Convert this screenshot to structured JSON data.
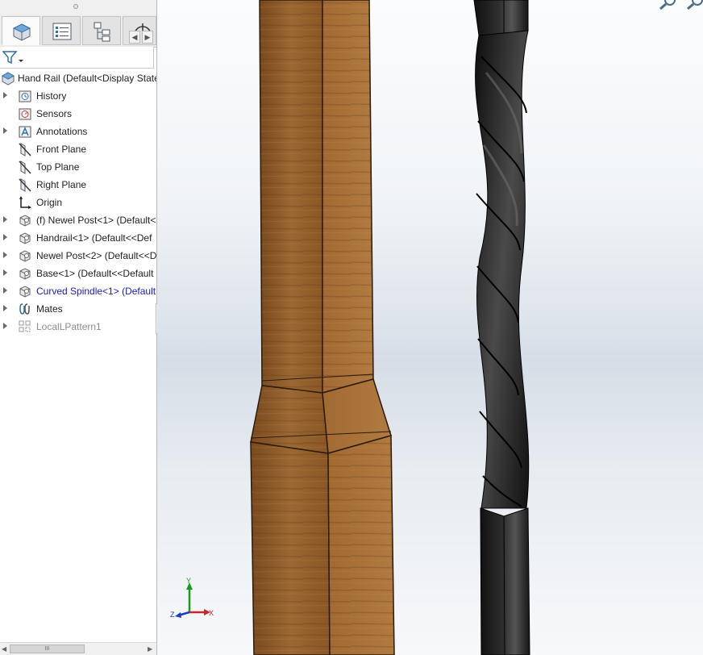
{
  "colors": {
    "panel_bg": "#ffffff",
    "highlight_text": "#1a1ab8",
    "wood": "#8a5a2b",
    "spindle": "#1e1e1e"
  },
  "tabs": [
    {
      "name": "featuremanager-tab",
      "icon": "assembly-icon"
    },
    {
      "name": "propertymanager-tab",
      "icon": "property-list-icon"
    },
    {
      "name": "configurationmanager-tab",
      "icon": "configuration-icon"
    },
    {
      "name": "dimxpert-tab",
      "icon": "dimxpert-icon"
    }
  ],
  "filter": {
    "icon": "filter-icon"
  },
  "tree": {
    "root": {
      "label": "Hand Rail  (Default<Display State",
      "icon": "assembly-icon"
    },
    "items": [
      {
        "label": "History",
        "icon": "history-icon",
        "expandable": true
      },
      {
        "label": "Sensors",
        "icon": "sensor-icon",
        "expandable": false
      },
      {
        "label": "Annotations",
        "icon": "annotation-icon",
        "expandable": true
      },
      {
        "label": "Front Plane",
        "icon": "plane-icon",
        "expandable": false
      },
      {
        "label": "Top Plane",
        "icon": "plane-icon",
        "expandable": false
      },
      {
        "label": "Right Plane",
        "icon": "plane-icon",
        "expandable": false
      },
      {
        "label": "Origin",
        "icon": "origin-icon",
        "expandable": false
      },
      {
        "label": "(f) Newel Post<1> (Default<",
        "icon": "part-icon",
        "expandable": true
      },
      {
        "label": "Handrail<1> (Default<<Def",
        "icon": "part-icon",
        "expandable": true
      },
      {
        "label": "Newel Post<2> (Default<<D",
        "icon": "part-icon",
        "expandable": true
      },
      {
        "label": "Base<1> (Default<<Default",
        "icon": "part-icon",
        "expandable": true
      },
      {
        "label": "Curved Spindle<1> (Default",
        "icon": "part-icon",
        "expandable": true,
        "highlighted": true
      },
      {
        "label": "Mates",
        "icon": "mates-icon",
        "expandable": true
      },
      {
        "label": "LocalLPattern1",
        "icon": "pattern-icon",
        "expandable": true,
        "suppressed": true
      }
    ]
  },
  "triad": {
    "x": "X",
    "y": "Y",
    "z": "Z"
  },
  "scrollbar": {
    "left": "◀",
    "right": "▶",
    "grip": "III"
  },
  "tab_scroll": {
    "left": "◀",
    "right": "▶"
  }
}
